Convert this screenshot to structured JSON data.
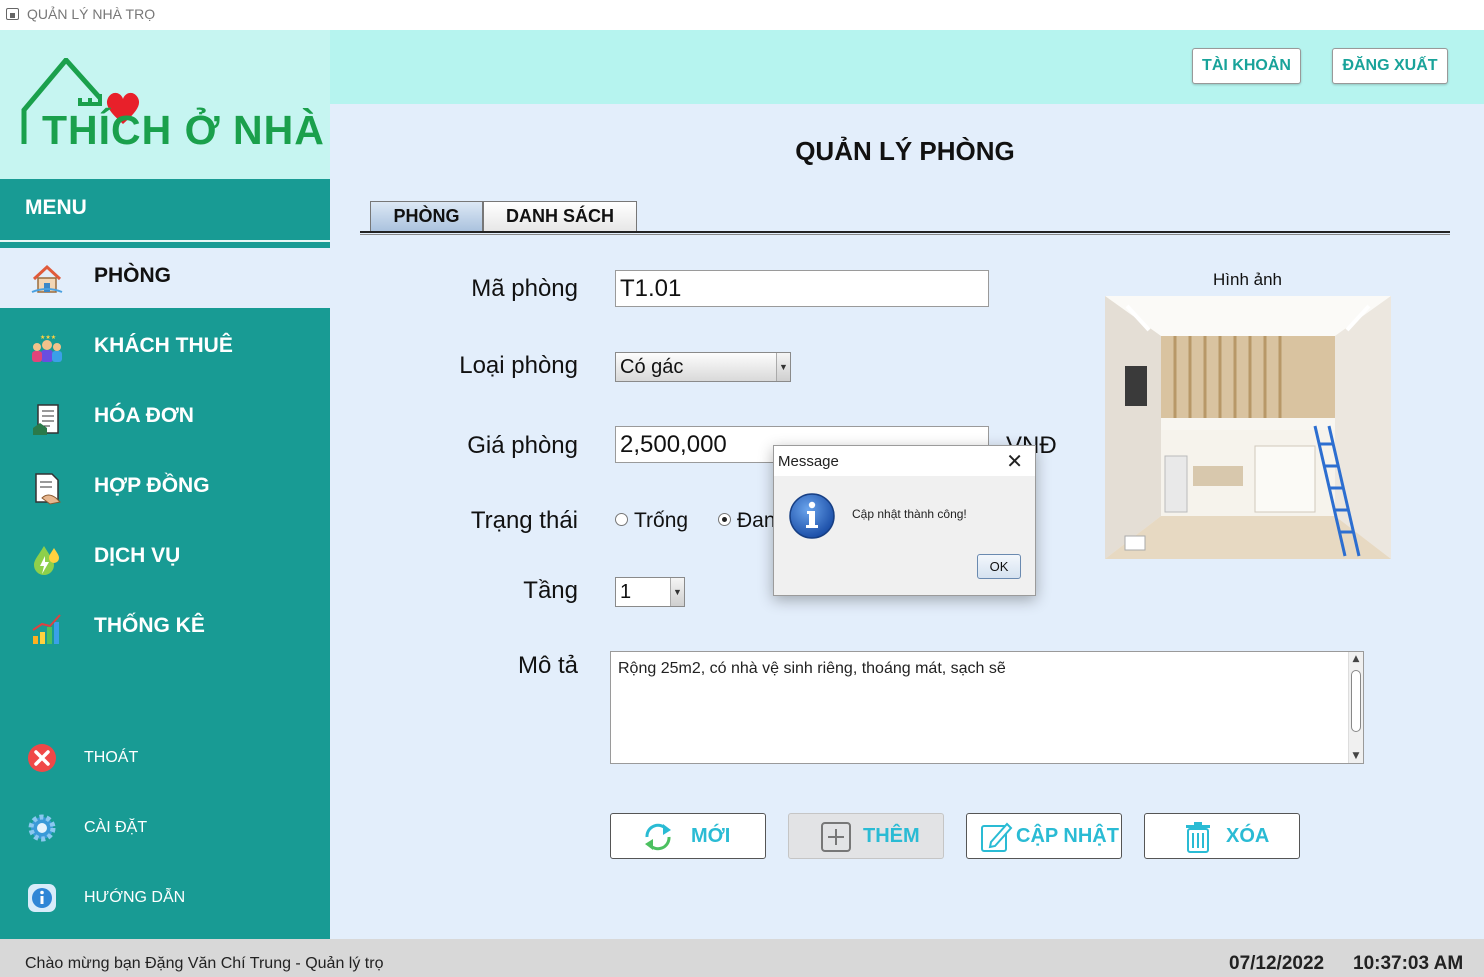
{
  "window": {
    "title": "QUẢN LÝ NHÀ TRỌ"
  },
  "logo": {
    "text": "THÍCH Ở NHÀ"
  },
  "sidebar": {
    "menu_label": "MENU",
    "items": [
      {
        "label": "PHÒNG",
        "icon": "home-icon",
        "active": true
      },
      {
        "label": "KHÁCH THUÊ",
        "icon": "people-icon",
        "active": false
      },
      {
        "label": "HÓA ĐƠN",
        "icon": "invoice-icon",
        "active": false
      },
      {
        "label": "HỢP ĐỒNG",
        "icon": "contract-icon",
        "active": false
      },
      {
        "label": "DỊCH VỤ",
        "icon": "service-icon",
        "active": false
      },
      {
        "label": "THỐNG KÊ",
        "icon": "statistics-icon",
        "active": false
      }
    ],
    "bottom": [
      {
        "label": "THOÁT",
        "icon": "exit-icon"
      },
      {
        "label": "CÀI ĐẶT",
        "icon": "settings-icon"
      },
      {
        "label": "HƯỚNG DẪN",
        "icon": "info-icon"
      }
    ]
  },
  "header": {
    "account_label": "TÀI KHOẢN",
    "logout_label": "ĐĂNG XUẤT"
  },
  "main": {
    "title": "QUẢN LÝ PHÒNG",
    "tabs": [
      {
        "label": "PHÒNG",
        "active": true
      },
      {
        "label": "DANH SÁCH",
        "active": false
      }
    ],
    "form": {
      "room_code_label": "Mã phòng",
      "room_code_value": "T1.01",
      "room_type_label": "Loại phòng",
      "room_type_value": "Có gác",
      "price_label": "Giá phòng",
      "price_value": "2,500,000",
      "price_unit": "VNĐ",
      "status_label": "Trạng thái",
      "status_options": [
        {
          "label": "Trống",
          "selected": false
        },
        {
          "label": "Đan",
          "selected": true
        }
      ],
      "floor_label": "Tầng",
      "floor_value": "1",
      "description_label": "Mô tả",
      "description_value": "Rộng 25m2, có nhà vệ sinh riêng, thoáng mát, sạch sẽ"
    },
    "image_label": "Hình ảnh",
    "actions": {
      "new_label": "MỚI",
      "add_label": "THÊM",
      "update_label": "CẬP NHẬT",
      "delete_label": "XÓA"
    }
  },
  "dialog": {
    "title": "Message",
    "message": "Cập nhật thành công!",
    "ok_label": "OK"
  },
  "statusbar": {
    "welcome": "Chào mừng bạn Đặng Văn Chí Trung - Quản lý trọ",
    "date": "07/12/2022",
    "time": "10:37:03 AM"
  },
  "colors": {
    "sidebar": "#189b94",
    "header": "#b6f4ef",
    "accent": "#2abbd4",
    "logo": "#1aa04c",
    "heart": "#e8202a"
  }
}
